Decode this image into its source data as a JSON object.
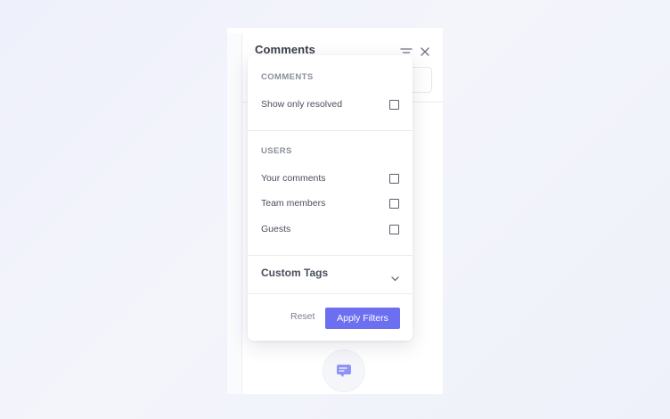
{
  "panel": {
    "title": "Comments",
    "icons": {
      "filter": "filter-icon",
      "close": "close-icon",
      "comment": "comment-icon"
    }
  },
  "popover": {
    "comments_section": {
      "heading": "COMMENTS",
      "options": [
        {
          "label": "Show only resolved",
          "checked": false
        }
      ]
    },
    "users_section": {
      "heading": "USERS",
      "options": [
        {
          "label": "Your comments",
          "checked": false
        },
        {
          "label": "Team members",
          "checked": false
        },
        {
          "label": "Guests",
          "checked": false
        }
      ]
    },
    "custom_tags": {
      "label": "Custom Tags",
      "icon": "chevron-down-icon",
      "expanded": false
    },
    "footer": {
      "reset_label": "Reset",
      "apply_label": "Apply Filters"
    }
  },
  "colors": {
    "accent": "#6b6ff0",
    "background": "#eef0fb"
  }
}
